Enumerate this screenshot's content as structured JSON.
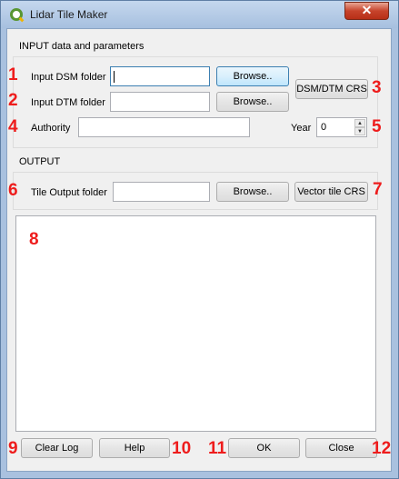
{
  "window": {
    "title": "Lidar Tile Maker",
    "close_glyph": "✕"
  },
  "input_section": {
    "title": "INPUT data and parameters",
    "dsm_label": "Input DSM folder",
    "dsm_value": "",
    "dtm_label": "Input DTM folder",
    "dtm_value": "",
    "browse_label": "Browse..",
    "crs_label": "DSM/DTM CRS",
    "authority_label": "Authority",
    "authority_value": "",
    "year_label": "Year",
    "year_value": "0"
  },
  "output_section": {
    "title": "OUTPUT",
    "tile_label": "Tile Output folder",
    "tile_value": "",
    "browse_label": "Browse..",
    "crs_label": "Vector tile CRS"
  },
  "footer": {
    "clear_log": "Clear Log",
    "help": "Help",
    "ok": "OK",
    "close": "Close"
  },
  "annotations": [
    "1",
    "2",
    "3",
    "4",
    "5",
    "6",
    "7",
    "8",
    "9",
    "10",
    "11",
    "12"
  ],
  "colors": {
    "annotation": "#ee1c1c",
    "titlebar": "#a9c1df",
    "close_button": "#c7432b",
    "focus_border": "#3c7fb1"
  },
  "icons": {
    "app": "qgis-icon",
    "spin_up": "▲",
    "spin_down": "▼"
  }
}
